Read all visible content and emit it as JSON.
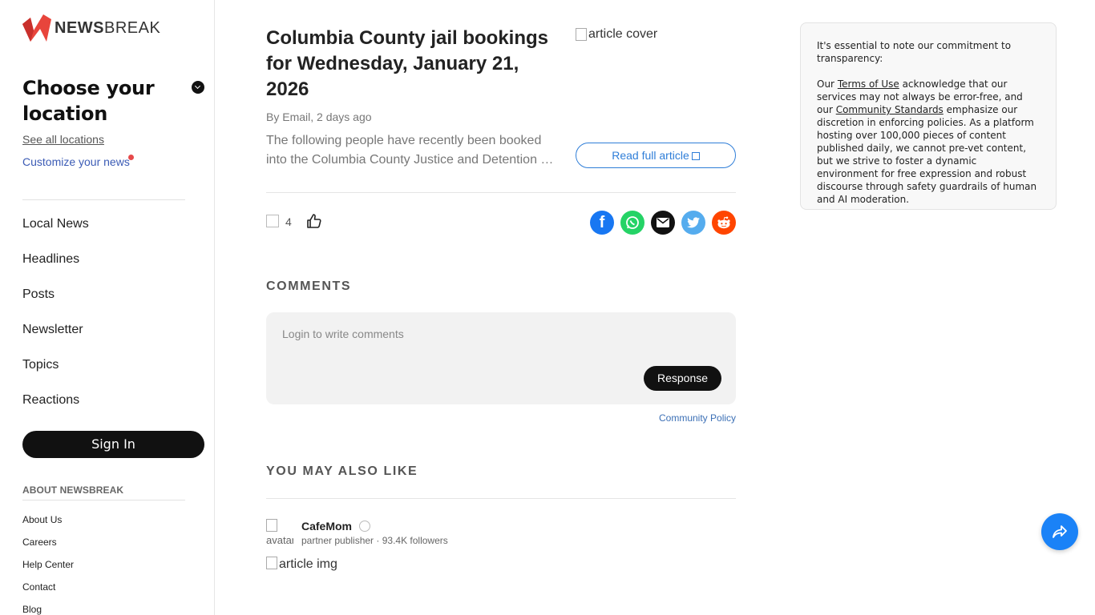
{
  "brand": {
    "name_bold": "NEWS",
    "name_rest": "BREAK"
  },
  "sidebar": {
    "choose_location": "Choose your location",
    "see_all_locations": "See all locations",
    "customize_news": "Customize your news",
    "nav": [
      "Local News",
      "Headlines",
      "Posts",
      "Newsletter",
      "Topics",
      "Reactions"
    ],
    "sign_in": "Sign In",
    "about_heading": "ABOUT NEWSBREAK",
    "about_links": [
      "About Us",
      "Careers",
      "Help Center",
      "Contact",
      "Blog"
    ]
  },
  "article": {
    "title": "Columbia County jail bookings for Wednesday, January 21, 2026",
    "cover_alt": "article cover",
    "byline": "By Email, 2 days ago",
    "excerpt_line1": "The following people have recently been booked",
    "excerpt_line2": "into the Columbia County Justice and Detention Center",
    "read_full": "Read full article",
    "reaction_count": "4"
  },
  "share": [
    {
      "name": "facebook",
      "color": "#1877f2"
    },
    {
      "name": "whatsapp",
      "color": "#25d366"
    },
    {
      "name": "email",
      "color": "#111111"
    },
    {
      "name": "twitter",
      "color": "#55acee"
    },
    {
      "name": "reddit",
      "color": "#ff4500"
    }
  ],
  "comments": {
    "heading": "COMMENTS",
    "placeholder": "Login to write comments",
    "response_button": "Response",
    "community_policy": "Community Policy"
  },
  "also_like": {
    "heading": "YOU MAY ALSO LIKE",
    "avatar_alt": "avatar",
    "publisher": "CafeMom",
    "meta": "partner publisher · 93.4K followers",
    "image_alt": "article img"
  },
  "notice": {
    "intro": "It's essential to note our commitment to transparency:",
    "p_start": "Our ",
    "terms": "Terms of Use",
    "p_mid": " acknowledge that our services may not always be error-free, and our ",
    "standards": "Community Standards",
    "p_end": " emphasize our discretion in enforcing policies. As a platform hosting over 100,000 pieces of content published daily, we cannot pre-vet content, but we strive to foster a dynamic environment for free expression and robust discourse through safety guardrails of human and AI moderation."
  }
}
